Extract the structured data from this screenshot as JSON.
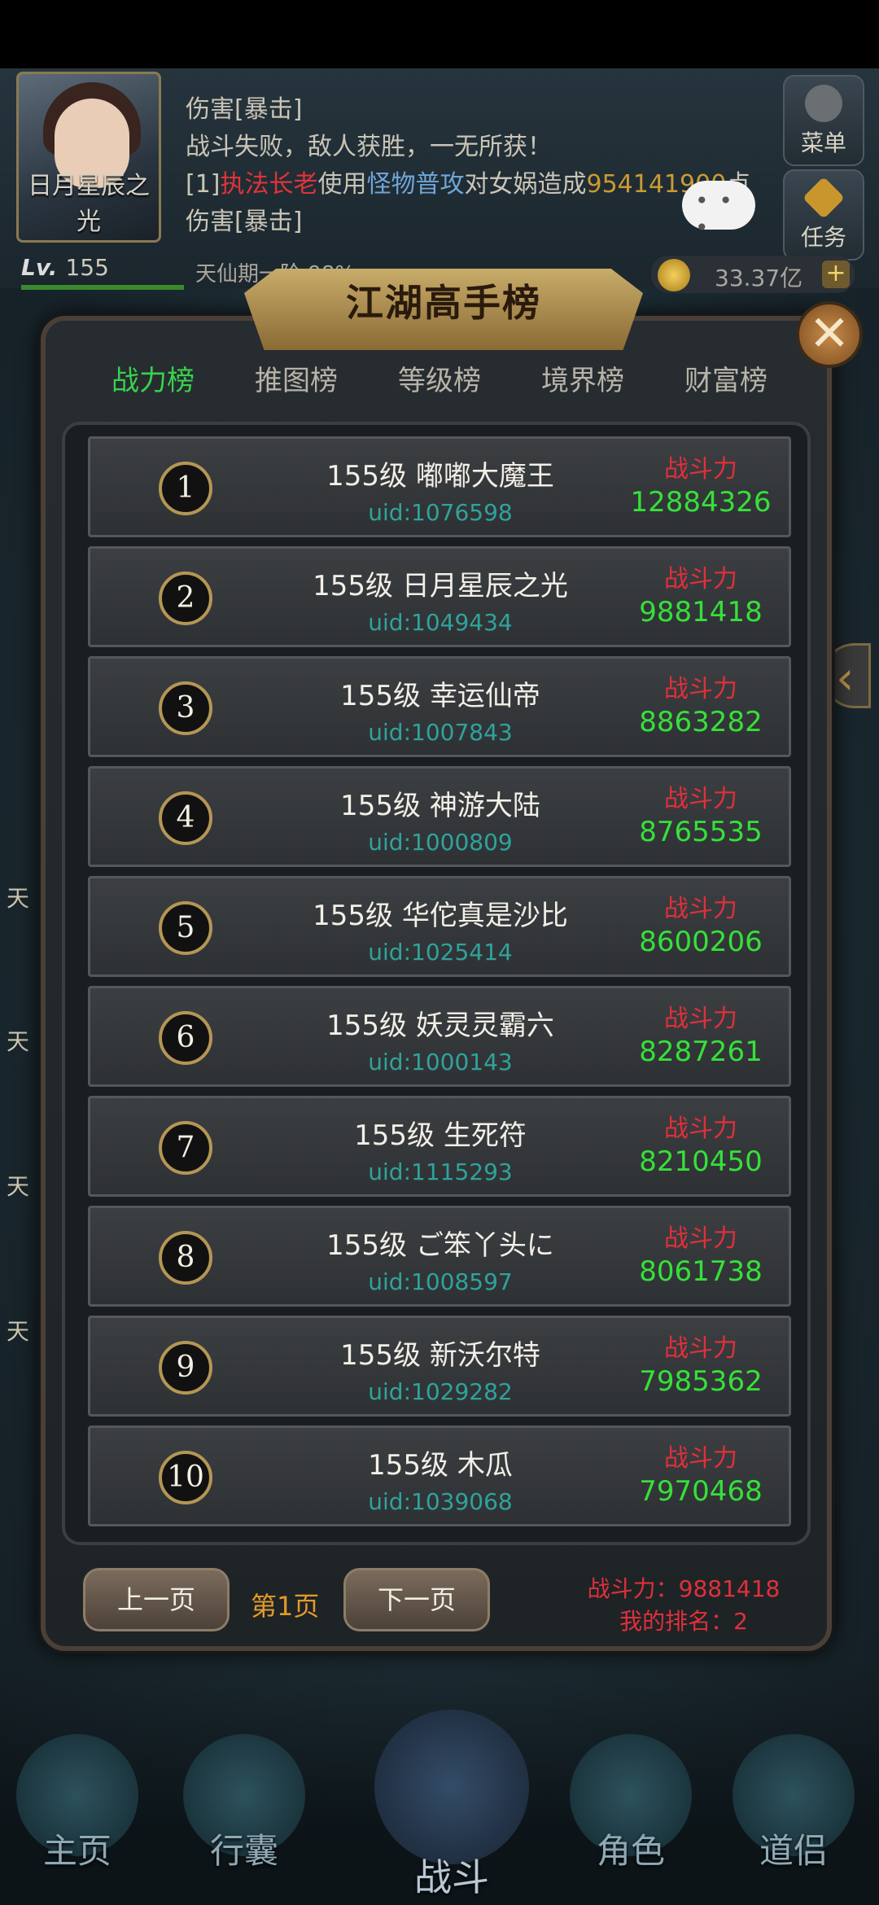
{
  "hud": {
    "player_name": "日月星辰之光",
    "level_prefix": "Lv.",
    "level": "155",
    "realm": "天仙期一阶",
    "realm_percent": "98%",
    "gold": "33.37亿",
    "menu_label": "菜单",
    "task_label": "任务",
    "chat": {
      "line1": "伤害[暴击]",
      "line2": "战斗失败，敌人获胜，一无所获！",
      "line3_prefix": "[1]",
      "line3_actor": "执法长老",
      "line3_verb": "使用",
      "line3_skill": "怪物普攻",
      "line3_to": "对女娲造成",
      "line3_damage": "954141900",
      "line3_suffix": "点",
      "line4": "伤害[暴击]"
    }
  },
  "side_chars": [
    "天",
    "天",
    "天",
    "天"
  ],
  "panel": {
    "title": "江湖高手榜",
    "close": "✕",
    "tabs": [
      "战力榜",
      "推图榜",
      "等级榜",
      "境界榜",
      "财富榜"
    ],
    "active_tab": 0
  },
  "ranking": [
    {
      "rank": "1",
      "name": "155级 嘟嘟大魔王",
      "uid": "uid:1076598",
      "power_label": "战斗力",
      "power": "12884326"
    },
    {
      "rank": "2",
      "name": "155级 日月星辰之光",
      "uid": "uid:1049434",
      "power_label": "战斗力",
      "power": "9881418"
    },
    {
      "rank": "3",
      "name": "155级 幸运仙帝",
      "uid": "uid:1007843",
      "power_label": "战斗力",
      "power": "8863282"
    },
    {
      "rank": "4",
      "name": "155级 神游大陆",
      "uid": "uid:1000809",
      "power_label": "战斗力",
      "power": "8765535"
    },
    {
      "rank": "5",
      "name": "155级 华佗真是沙比",
      "uid": "uid:1025414",
      "power_label": "战斗力",
      "power": "8600206"
    },
    {
      "rank": "6",
      "name": "155级 妖灵灵霸六",
      "uid": "uid:1000143",
      "power_label": "战斗力",
      "power": "8287261"
    },
    {
      "rank": "7",
      "name": "155级 生死符",
      "uid": "uid:1115293",
      "power_label": "战斗力",
      "power": "8210450"
    },
    {
      "rank": "8",
      "name": "155级 ご笨丫头に",
      "uid": "uid:1008597",
      "power_label": "战斗力",
      "power": "8061738"
    },
    {
      "rank": "9",
      "name": "155级 新沃尔特",
      "uid": "uid:1029282",
      "power_label": "战斗力",
      "power": "7985362"
    },
    {
      "rank": "10",
      "name": "155级 木瓜",
      "uid": "uid:1039068",
      "power_label": "战斗力",
      "power": "7970468"
    }
  ],
  "footer": {
    "prev_label": "上一页",
    "page_label": "第1页",
    "next_label": "下一页",
    "my_power": "战斗力：9881418",
    "my_rank": "我的排名：2"
  },
  "bottom_nav": [
    "主页",
    "行囊",
    "战斗",
    "角色",
    "道侣"
  ]
}
